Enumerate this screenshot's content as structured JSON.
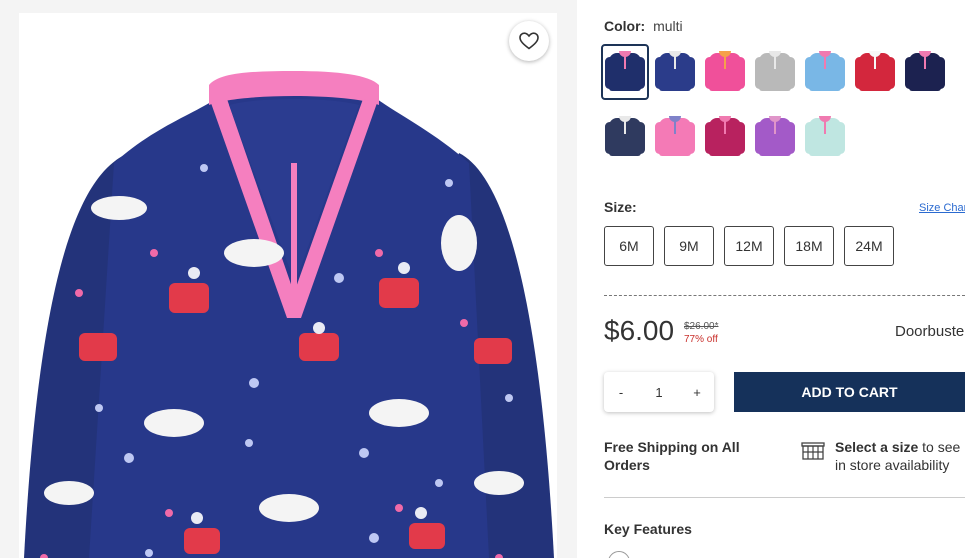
{
  "product": {
    "favorite_icon": "heart-outline-icon",
    "image_alt": "Navy fleece half-zip pullover with unicorn and Santa sleigh print"
  },
  "color": {
    "label": "Color:",
    "value": "multi",
    "swatches": [
      {
        "name": "navy-unicorn",
        "body": "#1f2f6b",
        "trim": "#f07ab0",
        "selected": true
      },
      {
        "name": "navy-print",
        "body": "#2b3c8a",
        "trim": "#e8e8e8",
        "selected": false
      },
      {
        "name": "pink-colorblock",
        "body": "#f0509a",
        "trim": "#f6a04a",
        "selected": false
      },
      {
        "name": "grey-print",
        "body": "#b9b9b9",
        "trim": "#e8e8e8",
        "selected": false
      },
      {
        "name": "rainbow-stripe",
        "body": "#79b7e6",
        "trim": "#f07ab0",
        "selected": false
      },
      {
        "name": "red-fairisle",
        "body": "#d3273d",
        "trim": "#f7f7f7",
        "selected": false
      },
      {
        "name": "navy-hearts",
        "body": "#1c2250",
        "trim": "#f07ab0",
        "selected": false
      },
      {
        "name": "navy-stripe",
        "body": "#2f3a5f",
        "trim": "#e9e9e9",
        "selected": false
      },
      {
        "name": "pink-solid",
        "body": "#f47ab6",
        "trim": "#7f82c9",
        "selected": false
      },
      {
        "name": "berry-print",
        "body": "#b8225f",
        "trim": "#f07ab0",
        "selected": false
      },
      {
        "name": "purple-colorblock",
        "body": "#a35ac8",
        "trim": "#e095c9",
        "selected": false
      },
      {
        "name": "mint-print",
        "body": "#bfe6e1",
        "trim": "#f07ab0",
        "selected": false
      }
    ]
  },
  "size": {
    "label": "Size:",
    "chart_link": "Size Chart",
    "options": [
      "6M",
      "9M",
      "12M",
      "18M",
      "24M"
    ]
  },
  "pricing": {
    "price": "$6.00",
    "original": "$26.00*",
    "discount": "77% off",
    "badge": "Doorbuster"
  },
  "purchase": {
    "minus": "-",
    "quantity": "1",
    "plus": "+",
    "add_to_cart": "ADD TO CART"
  },
  "shipping": {
    "free_shipping": "Free Shipping on All Orders",
    "store_icon": "store-icon",
    "select_size_bold": "Select a size",
    "select_size_rest": " to see",
    "store_availability": "in store availability"
  },
  "features": {
    "heading": "Key Features",
    "info_icon": "info-icon"
  }
}
